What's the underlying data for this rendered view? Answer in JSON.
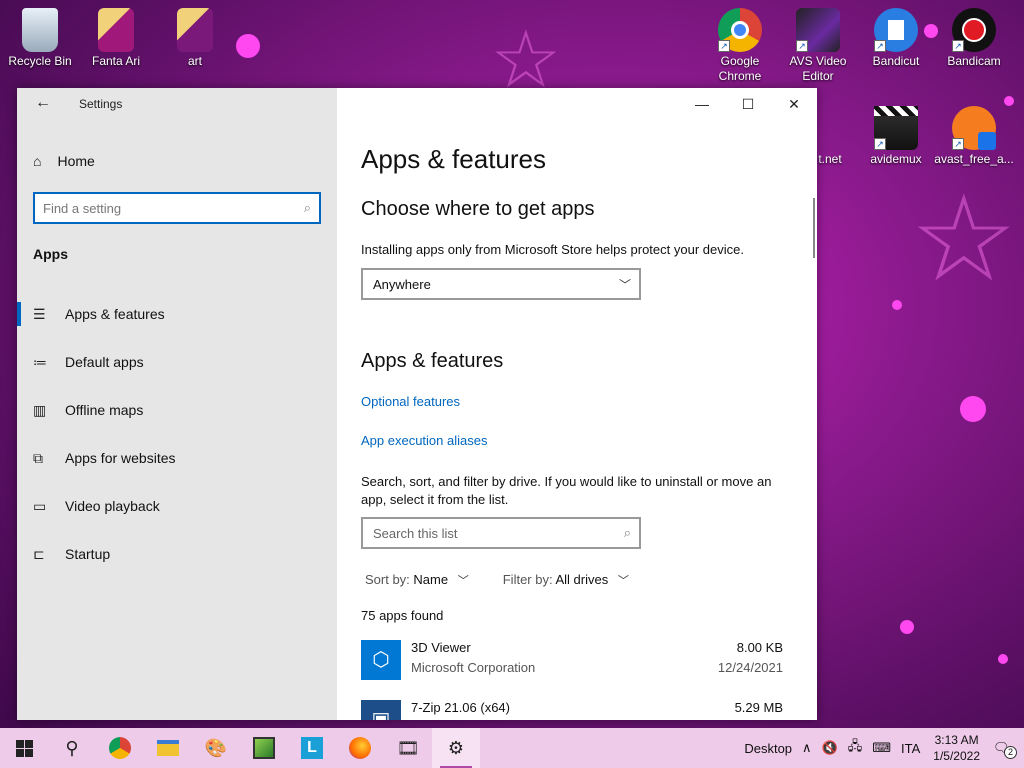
{
  "desktop": {
    "icons_left": [
      {
        "label": "Recycle Bin",
        "icon": "recycle-bin-icon"
      },
      {
        "label": "Fanta Ari",
        "icon": "folder-icon"
      },
      {
        "label": "art",
        "icon": "folder-icon"
      }
    ],
    "icons_right_row1": [
      {
        "label": "Google Chrome",
        "icon": "chrome-icon"
      },
      {
        "label": "AVS Video Editor",
        "icon": "film-icon"
      },
      {
        "label": "Bandicut",
        "icon": "bandicut-icon"
      },
      {
        "label": "Bandicam",
        "icon": "record-icon"
      }
    ],
    "icons_right_row2": [
      {
        "label": "t.net",
        "icon": "partial-icon"
      },
      {
        "label": "avidemux",
        "icon": "clapper-icon"
      },
      {
        "label": "avast_free_a...",
        "icon": "avast-icon"
      }
    ]
  },
  "window": {
    "title": "Settings",
    "back_icon": "←",
    "minimize": "—",
    "maximize": "☐",
    "close": "✕"
  },
  "sidebar": {
    "home_label": "Home",
    "search_placeholder": "Find a setting",
    "section_label": "Apps",
    "items": [
      {
        "label": "Apps & features",
        "icon": "☰"
      },
      {
        "label": "Default apps",
        "icon": "≔"
      },
      {
        "label": "Offline maps",
        "icon": "▥"
      },
      {
        "label": "Apps for websites",
        "icon": "⧉"
      },
      {
        "label": "Video playback",
        "icon": "▭"
      },
      {
        "label": "Startup",
        "icon": "⊏"
      }
    ]
  },
  "main": {
    "page_title": "Apps & features",
    "choose_heading": "Choose where to get apps",
    "choose_desc": "Installing apps only from Microsoft Store helps protect your device.",
    "source_dropdown_value": "Anywhere",
    "features_heading": "Apps & features",
    "link_optional": "Optional features",
    "link_aliases": "App execution aliases",
    "search_desc": "Search, sort, and filter by drive. If you would like to uninstall or move an app, select it from the list.",
    "list_search_placeholder": "Search this list",
    "sort_label": "Sort by:",
    "sort_value": "Name",
    "filter_label": "Filter by:",
    "filter_value": "All drives",
    "apps_count": "75 apps found",
    "apps": [
      {
        "name": "3D Viewer",
        "publisher": "Microsoft Corporation",
        "size": "8.00 KB",
        "date": "12/24/2021"
      },
      {
        "name": "7-Zip 21.06 (x64)",
        "publisher": "",
        "size": "5.29 MB",
        "date": ""
      }
    ]
  },
  "taskbar": {
    "desktop_label": "Desktop",
    "language": "ITA",
    "time": "3:13 AM",
    "date": "1/5/2022",
    "notification_count": "2"
  },
  "colors": {
    "accent": "#0067c0",
    "taskbar": "#eecbe9",
    "sidebar": "#e6e6e6",
    "wallpaper": "#8a1a8c"
  }
}
